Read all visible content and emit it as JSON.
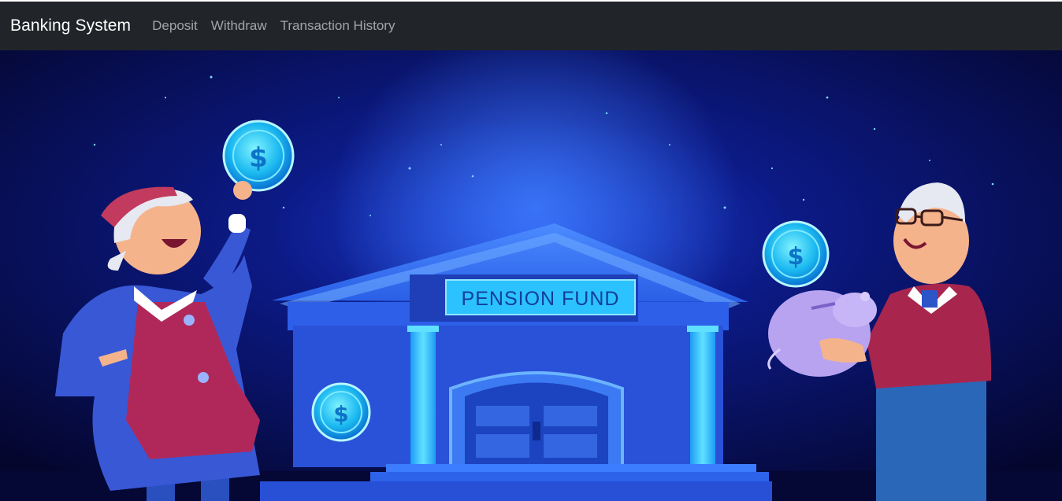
{
  "navbar": {
    "brand": "Banking System",
    "links": [
      "Deposit",
      "Withdraw",
      "Transaction History"
    ],
    "background": "#212529"
  },
  "hero": {
    "sign_text": "PENSION FUND",
    "coin_symbol": "$",
    "background": "#06083a",
    "accent": "#1f6fff"
  }
}
